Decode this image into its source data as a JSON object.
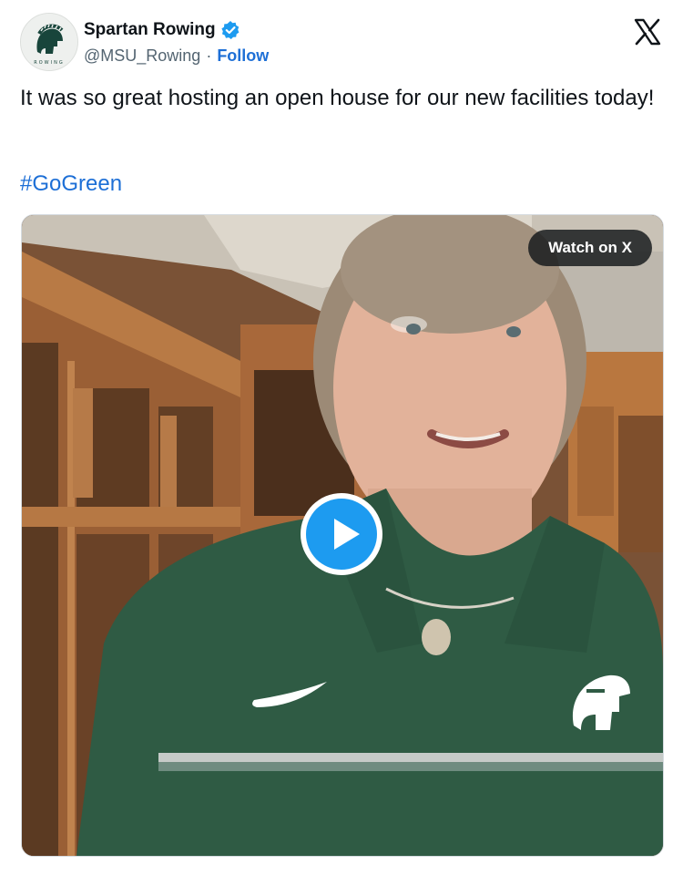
{
  "account": {
    "display_name": "Spartan Rowing",
    "handle": "@MSU_Rowing",
    "separator": "·",
    "follow_label": "Follow",
    "avatar_caption": "ROWING"
  },
  "post": {
    "text": "It was so great hosting an open house for our new facilities today!",
    "hashtag": "#GoGreen"
  },
  "media": {
    "watch_label": "Watch on X"
  },
  "colors": {
    "link": "#1d6fd6",
    "verified": "#1d9bf0",
    "play": "#1d9bf0",
    "msu_green": "#18453b"
  }
}
